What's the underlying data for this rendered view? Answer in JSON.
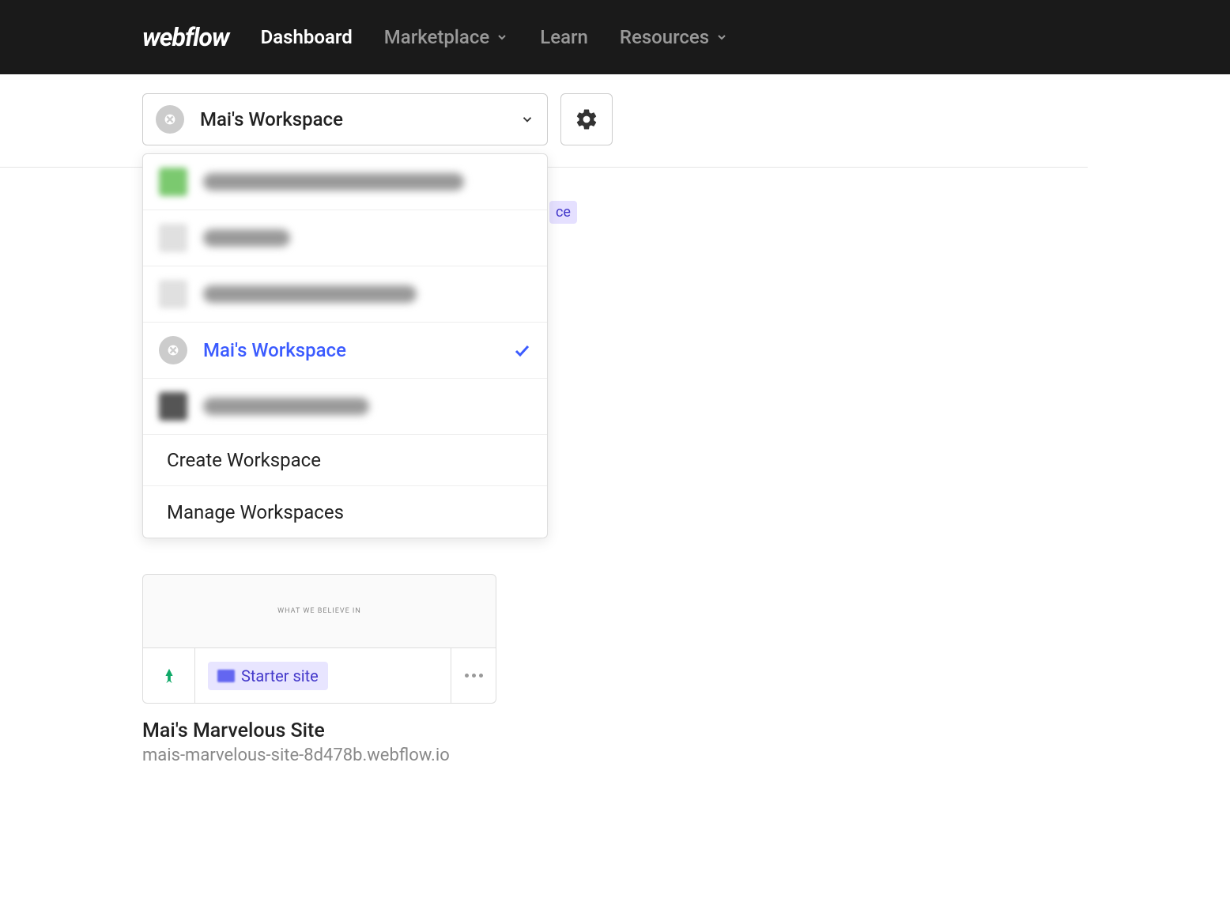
{
  "nav": {
    "logo": "webflow",
    "items": [
      "Dashboard",
      "Marketplace",
      "Learn",
      "Resources"
    ],
    "active_index": 0,
    "has_dropdown": [
      false,
      true,
      false,
      true
    ]
  },
  "workspace_selector": {
    "current": "Mai's Workspace"
  },
  "dropdown": {
    "items": [
      {
        "blurred": true,
        "icon_color": "#7bc96f",
        "text_width": "330px"
      },
      {
        "blurred": true,
        "icon_color": "#e0e0e0",
        "text_width": "110px"
      },
      {
        "blurred": true,
        "icon_color": "#e0e0e0",
        "text_width": "270px"
      },
      {
        "blurred": false,
        "label": "Mai's Workspace",
        "selected": true
      },
      {
        "blurred": true,
        "icon_color": "#555",
        "text_width": "210px"
      }
    ],
    "actions": [
      "Create Workspace",
      "Manage Workspaces"
    ]
  },
  "badge_behind": "ce",
  "site_card": {
    "preview_text": "WHAT WE BELIEVE IN",
    "badge": "Starter site",
    "title": "Mai's Marvelous Site",
    "url": "mais-marvelous-site-8d478b.webflow.io"
  }
}
